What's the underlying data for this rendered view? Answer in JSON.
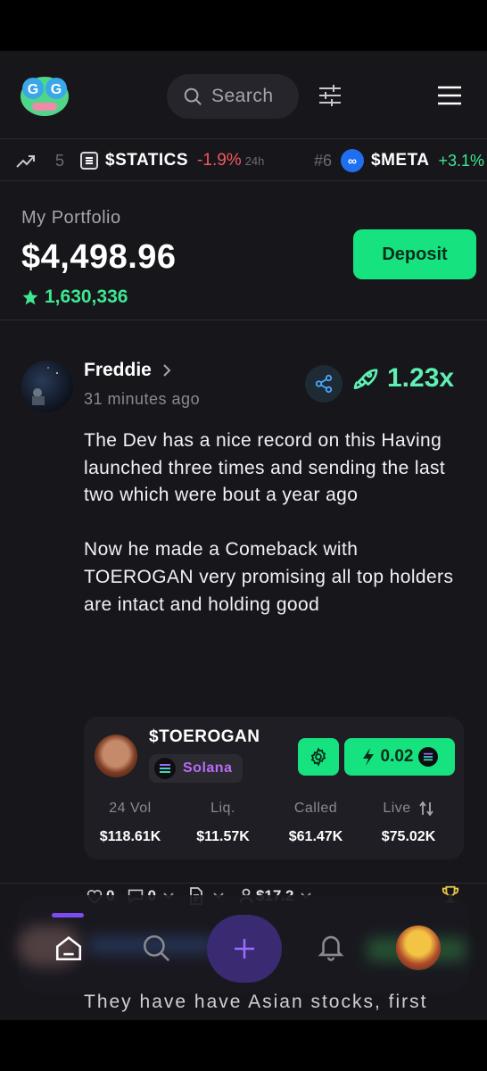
{
  "header": {
    "search_placeholder": "Search",
    "icons": {
      "logo": "gg-frog-logo",
      "search": "search-icon",
      "filter": "sliders-icon",
      "menu": "hamburger-menu-icon"
    }
  },
  "ticker": {
    "items": [
      {
        "rank": "5",
        "symbol": "$STATICS",
        "change": "-1.9%",
        "period": "24h"
      },
      {
        "rank": "#6",
        "symbol": "$META",
        "change": "+3.1%"
      }
    ]
  },
  "portfolio": {
    "label": "My Portfolio",
    "value": "$4,498.96",
    "points": "1,630,336",
    "deposit_label": "Deposit"
  },
  "post": {
    "author": "Freddie",
    "time": "31 minutes ago",
    "multiplier": "1.23x",
    "paragraphs": [
      "The Dev has a nice record on this Having launched three times and sending the last two which were bout a year ago",
      "Now he made a Comeback with TOEROGAN very promising all top holders are intact and holding good"
    ],
    "token": {
      "name": "$TOEROGAN",
      "chain": "Solana",
      "buy_amount": "0.02",
      "stats": [
        {
          "label": "24 Vol",
          "value": "$118.61K"
        },
        {
          "label": "Liq.",
          "value": "$11.57K"
        },
        {
          "label": "Called",
          "value": "$61.47K"
        },
        {
          "label": "Live",
          "value": "$75.02K"
        }
      ]
    },
    "actions": {
      "likes": "0",
      "comments": "0",
      "tip": "$17.2"
    }
  },
  "next_post_preview": "They have have Asian stocks, first",
  "colors": {
    "accent_green": "#16e37f",
    "negative": "#f0585e",
    "positive": "#3ee892",
    "solana_purple": "#b86cf5",
    "background": "#17161b"
  }
}
